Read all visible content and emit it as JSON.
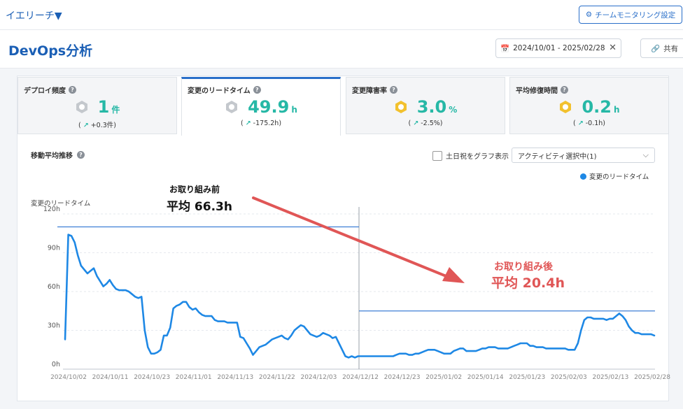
{
  "topbar": {
    "org": "イエリーチ▼",
    "team_button": "チームモニタリング設定"
  },
  "header": {
    "title": "DevOps分析",
    "date_range": "2024/10/01 - 2025/02/28",
    "share": "共有"
  },
  "colors": {
    "accent": "#2a6fc9",
    "teal": "#26b8a6",
    "line": "#1e88e5",
    "annotation": "#e05656"
  },
  "cards": [
    {
      "label": "デプロイ頻度",
      "value": "1",
      "unit": "件",
      "delta": "+0.3件",
      "badge": "hexagon-gray-icon",
      "active": false
    },
    {
      "label": "変更のリードタイム",
      "value": "49.9",
      "unit": "h",
      "delta": "-175.2h",
      "badge": "hexagon-gray-icon",
      "active": true
    },
    {
      "label": "変更障害率",
      "value": "3.0",
      "unit": "%",
      "delta": "-2.5%",
      "badge": "hexagon-gold-icon",
      "active": false
    },
    {
      "label": "平均修復時間",
      "value": "0.2",
      "unit": "h",
      "delta": "-0.1h",
      "badge": "hexagon-gold-icon",
      "active": false
    }
  ],
  "section": {
    "title": "移動平均推移",
    "weekend_checkbox": "土日祝をグラフ表示",
    "activity_select": "アクティビティ選択中(1)"
  },
  "annotations": {
    "before_label": "お取り組み前",
    "before_value": "平均 66.3h",
    "after_label": "お取り組み後",
    "after_value": "平均 20.4h"
  },
  "chart_data": {
    "type": "line",
    "ylabel": "変更のリードタイム",
    "y_unit": "h",
    "ylim": [
      0,
      120
    ],
    "y_ticks": [
      "0h",
      "30h",
      "60h",
      "90h",
      "120h"
    ],
    "x_tick_labels": [
      "2024/10/02",
      "2024/10/11",
      "2024/10/23",
      "2024/11/01",
      "2024/11/13",
      "2024/11/22",
      "2024/12/03",
      "2024/12/12",
      "2024/12/23",
      "2025/01/02",
      "2025/01/14",
      "2025/01/23",
      "2025/02/03",
      "2025/02/13",
      "2025/02/28"
    ],
    "grid": true,
    "legend": "top-right",
    "series": [
      {
        "name": "変更のリードタイム",
        "values": [
          23,
          104,
          103,
          98,
          88,
          80,
          77,
          74,
          76,
          78,
          72,
          68,
          64,
          66,
          69,
          65,
          62,
          61,
          61,
          61,
          60,
          58,
          56,
          55,
          56,
          30,
          17,
          12,
          12,
          13,
          15,
          26,
          26,
          32,
          47,
          49,
          50,
          52,
          52,
          48,
          46,
          47,
          44,
          42,
          41,
          41,
          41,
          38,
          37,
          37,
          37,
          36,
          36,
          36,
          36,
          25,
          24,
          20,
          16,
          11,
          14,
          17,
          18,
          19,
          21,
          23,
          24,
          25,
          26,
          24,
          23,
          26,
          30,
          32,
          34,
          33,
          30,
          27,
          26,
          25,
          26,
          28,
          27,
          26,
          24,
          25,
          20,
          15,
          10,
          9,
          10,
          9,
          10,
          10,
          10,
          10,
          10,
          10,
          10,
          10,
          10,
          10,
          10,
          10,
          11,
          12,
          12,
          12,
          11,
          11,
          12,
          12,
          13,
          14,
          15,
          15,
          15,
          14,
          13,
          12,
          12,
          12,
          14,
          15,
          16,
          16,
          14,
          14,
          14,
          14,
          15,
          16,
          16,
          17,
          17,
          17,
          16,
          16,
          16,
          16,
          17,
          18,
          19,
          20,
          20,
          20,
          18,
          18,
          17,
          17,
          17,
          16,
          16,
          16,
          16,
          16,
          16,
          16,
          15,
          15,
          15,
          20,
          30,
          38,
          40,
          40,
          39,
          39,
          39,
          39,
          38,
          39,
          39,
          41,
          43,
          41,
          38,
          33,
          30,
          28,
          28,
          27,
          27,
          27,
          27,
          26
        ]
      }
    ],
    "reference_lines": [
      {
        "label": "平均 66.3h",
        "value": 110
      },
      {
        "label": "平均 20.4h",
        "value": 45
      }
    ]
  }
}
